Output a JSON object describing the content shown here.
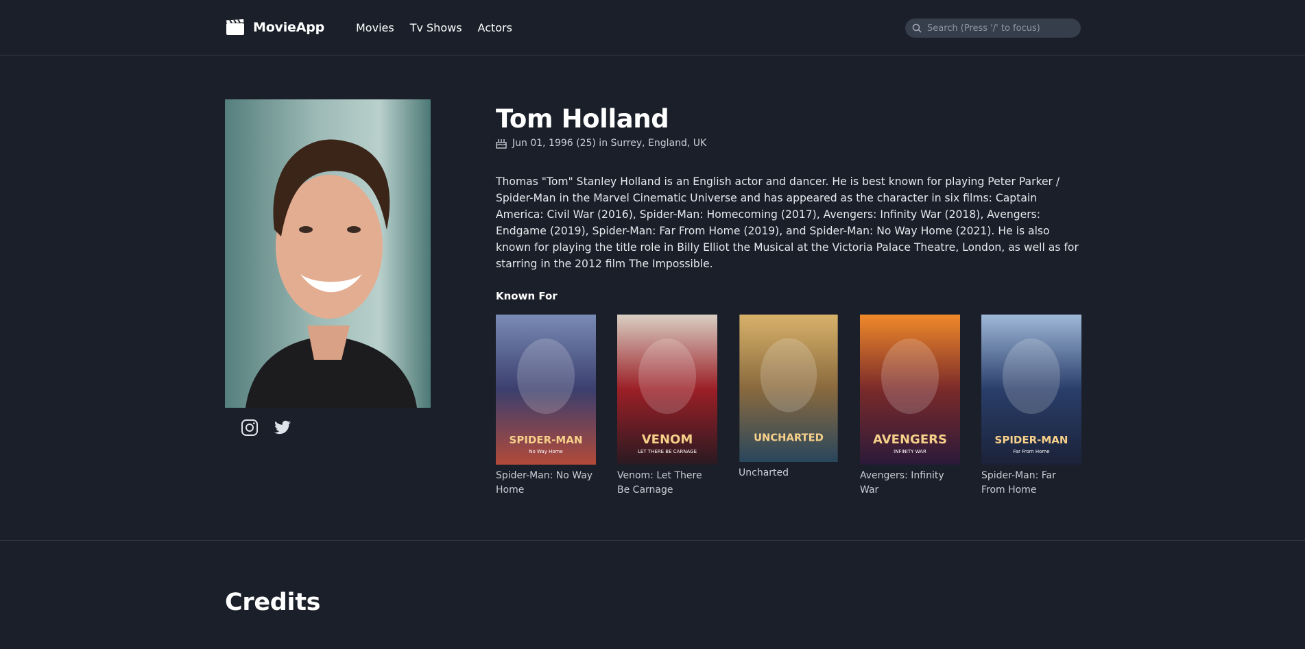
{
  "header": {
    "logo_text": "MovieApp",
    "nav": [
      "Movies",
      "Tv Shows",
      "Actors"
    ],
    "search_placeholder": "Search (Press '/' to focus)"
  },
  "actor": {
    "name": "Tom Holland",
    "birth": "Jun 01, 1996 (25) in Surrey, England, UK",
    "bio": "Thomas \"Tom\" Stanley Holland is an English actor and dancer. He is best known for playing Peter Parker / Spider-Man in the Marvel Cinematic Universe and has appeared as the character in six films: Captain America: Civil War (2016), Spider-Man: Homecoming (2017), Avengers: Infinity War (2018), Avengers: Endgame (2019), Spider-Man: Far From Home (2019), and Spider-Man: No Way Home (2021). He is also known for playing the title role in Billy Elliot the Musical at the Victoria Palace Theatre, London, as well as for starring in the 2012 film The Impossible."
  },
  "socials": [
    "instagram-icon",
    "twitter-icon"
  ],
  "known_for": {
    "title": "Known For",
    "movies": [
      {
        "title": "Spider-Man: No Way Home",
        "poster_text": "SPIDER-MAN",
        "poster_sub": "No Way Home",
        "colors": [
          "#7a8bb5",
          "#3b3f6e",
          "#b24a3a"
        ]
      },
      {
        "title": "Venom: Let There Be Carnage",
        "poster_text": "VENOM",
        "poster_sub": "LET THERE BE CARNAGE",
        "colors": [
          "#d9cfc4",
          "#9b1f26",
          "#2a1a22"
        ]
      },
      {
        "title": "Uncharted",
        "poster_text": "UNCHARTED",
        "poster_sub": "",
        "colors": [
          "#d8b26a",
          "#8a6a3e",
          "#29465c"
        ]
      },
      {
        "title": "Avengers: Infinity War",
        "poster_text": "AVENGERS",
        "poster_sub": "INFINITY WAR",
        "colors": [
          "#f08a2a",
          "#7a2a2a",
          "#2a1a3a"
        ]
      },
      {
        "title": "Spider-Man: Far From Home",
        "poster_text": "SPIDER-MAN",
        "poster_sub": "Far From Home",
        "colors": [
          "#9fb8d8",
          "#2a3e6a",
          "#1b2238"
        ]
      }
    ]
  },
  "credits_title": "Credits"
}
